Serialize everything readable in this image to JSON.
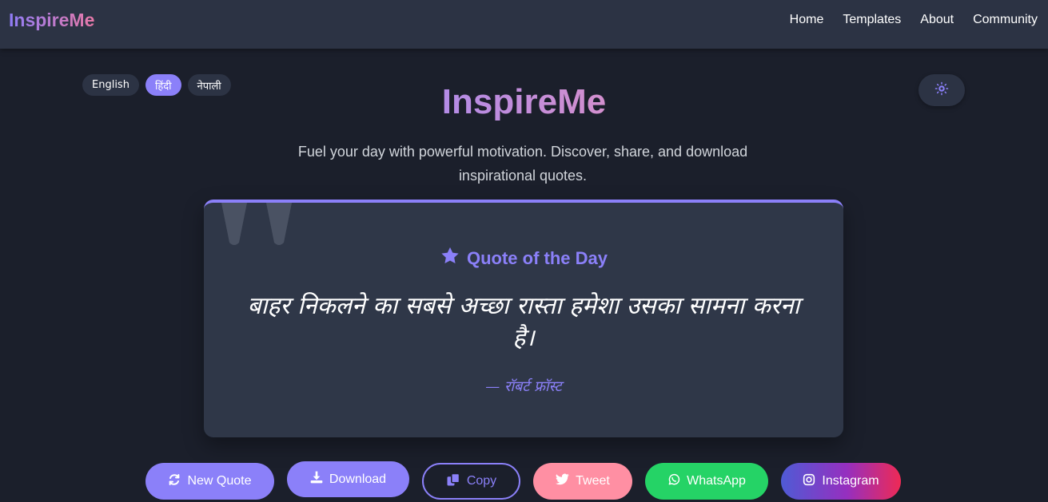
{
  "nav": {
    "brand": "InspireMe",
    "links": [
      "Home",
      "Templates",
      "About",
      "Community"
    ]
  },
  "languages": {
    "options": [
      "English",
      "हिंदी",
      "नेपाली"
    ],
    "selected": "हिंदी"
  },
  "theme_toggle": {
    "icon": "sun-gear-icon"
  },
  "hero": {
    "title": "InspireMe",
    "subtitle": "Fuel your day with powerful motivation. Discover, share, and download inspirational quotes."
  },
  "quote_card": {
    "heading": "Quote of the Day",
    "heading_icon": "star-icon",
    "text": "बाहर निकलने का सबसे अच्छा रास्ता हमेशा उसका सामना करना है।",
    "author": "— रॉबर्ट फ्रॉस्ट"
  },
  "actions": {
    "new_quote": "New Quote",
    "download": "Download",
    "copy": "Copy",
    "tweet": "Tweet",
    "whatsapp": "WhatsApp",
    "instagram": "Instagram"
  },
  "colors": {
    "accent": "#8b80f9",
    "background": "#1b1f2b",
    "card": "#2f3748",
    "tweet": "#ff8fa3",
    "whatsapp": "#25d366"
  }
}
